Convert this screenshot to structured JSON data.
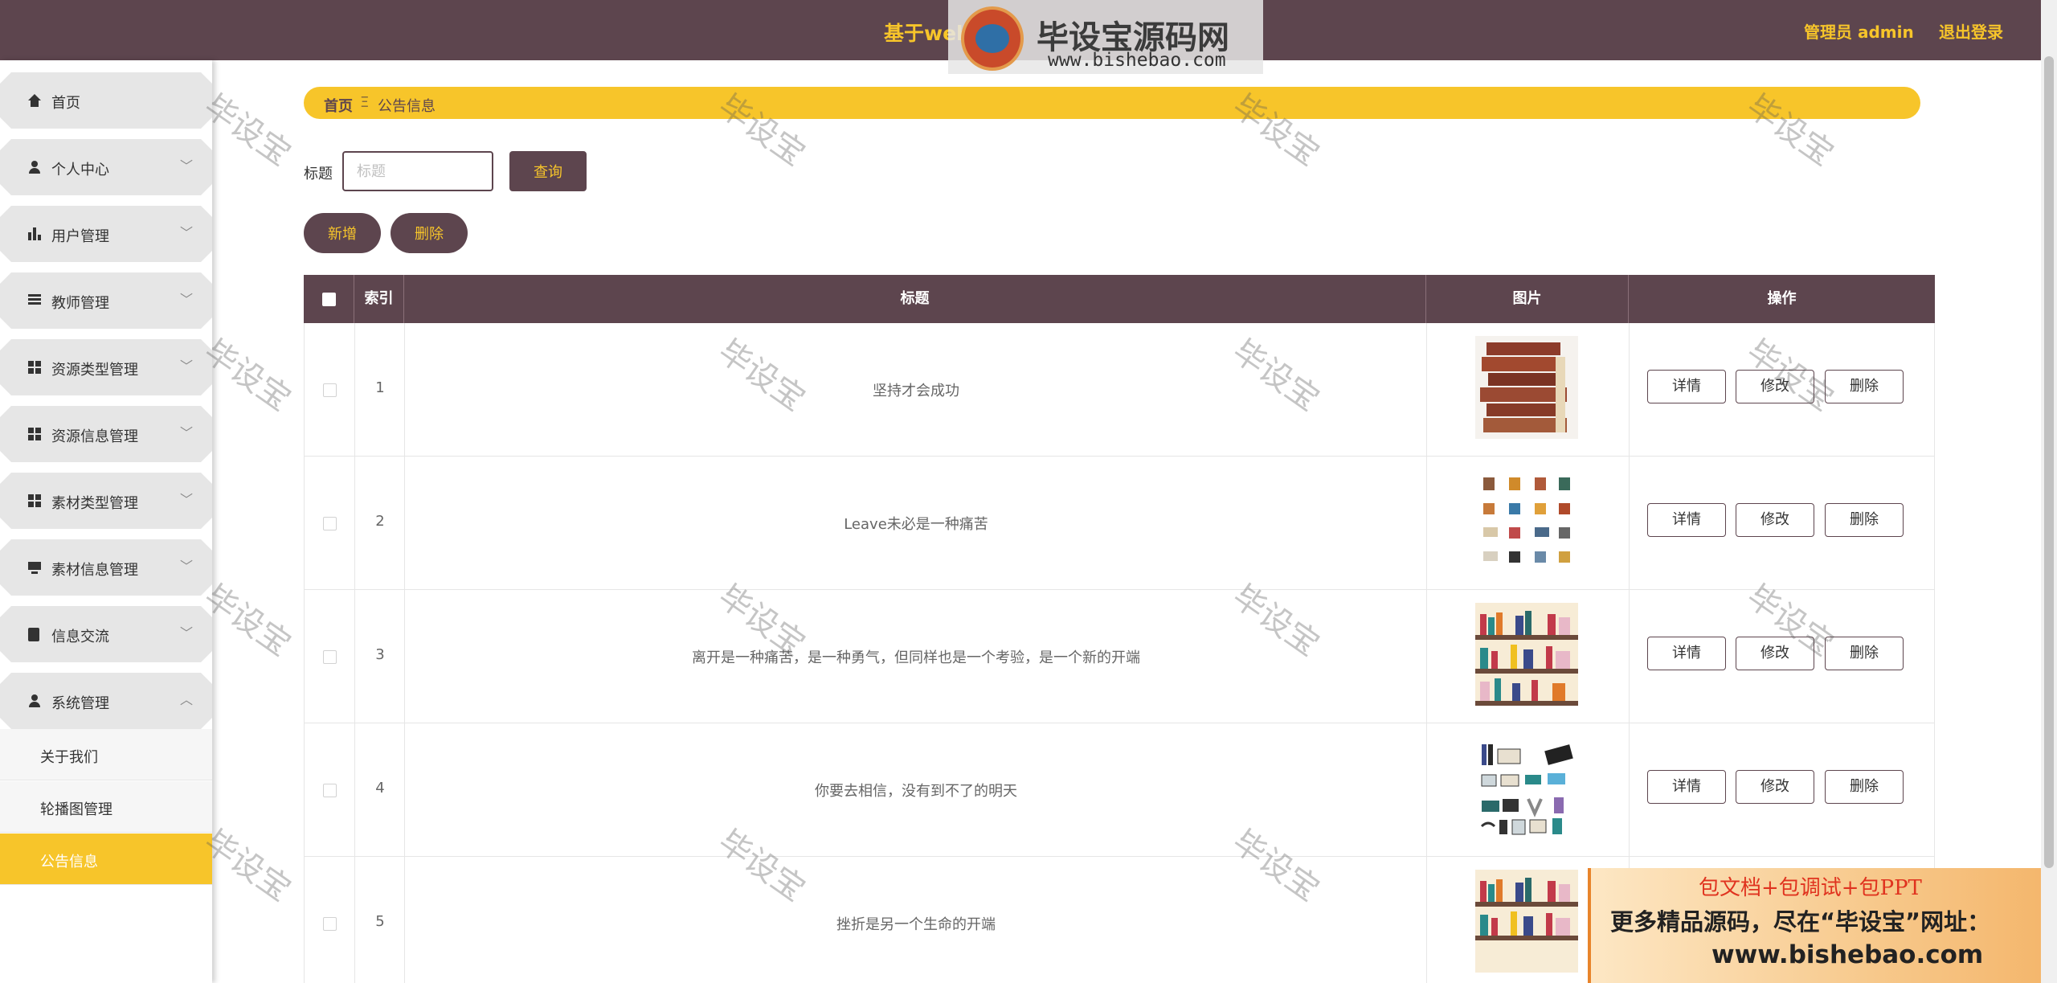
{
  "header": {
    "title": "基于web的",
    "admin_label": "管理员 admin",
    "logout_label": "退出登录"
  },
  "logo": {
    "name": "毕设宝源码网",
    "url": "www.bishebao.com"
  },
  "sidebar": {
    "items": [
      {
        "label": "首页",
        "icon": "home-icon",
        "expanded": false
      },
      {
        "label": "个人中心",
        "icon": "user-icon",
        "expanded": false
      },
      {
        "label": "用户管理",
        "icon": "bar-chart-icon",
        "expanded": false
      },
      {
        "label": "教师管理",
        "icon": "list-icon",
        "expanded": false
      },
      {
        "label": "资源类型管理",
        "icon": "grid-icon",
        "expanded": false
      },
      {
        "label": "资源信息管理",
        "icon": "grid-icon",
        "expanded": false
      },
      {
        "label": "素材类型管理",
        "icon": "grid-icon",
        "expanded": false
      },
      {
        "label": "素材信息管理",
        "icon": "monitor-icon",
        "expanded": false
      },
      {
        "label": "信息交流",
        "icon": "clipboard-icon",
        "expanded": false
      },
      {
        "label": "系统管理",
        "icon": "user-icon",
        "expanded": true
      }
    ],
    "sub_items": [
      {
        "label": "关于我们",
        "active": false
      },
      {
        "label": "轮播图管理",
        "active": false
      },
      {
        "label": "公告信息",
        "active": true
      }
    ]
  },
  "breadcrumb": {
    "home": "首页",
    "separator": "Ξ",
    "current": "公告信息"
  },
  "search": {
    "label": "标题",
    "placeholder": "标题",
    "value": "",
    "query_label": "查询"
  },
  "actions": {
    "add_label": "新增",
    "delete_label": "删除"
  },
  "table": {
    "columns": [
      "索引",
      "标题",
      "图片",
      "操作"
    ],
    "rows": [
      {
        "index": "1",
        "title": "坚持才会成功",
        "image": "stacked-books"
      },
      {
        "index": "2",
        "title": "Leave未必是一种痛苦",
        "image": "library-icons-grid"
      },
      {
        "index": "3",
        "title": "离开是一种痛苦，是一种勇气，但同样也是一个考验，是一个新的开端",
        "image": "bookshelf"
      },
      {
        "index": "4",
        "title": "你要去相信，没有到不了的明天",
        "image": "book-icons-grid"
      },
      {
        "index": "5",
        "title": "挫折是另一个生命的开端",
        "image": "bookshelf"
      }
    ],
    "row_actions": {
      "detail": "详情",
      "edit": "修改",
      "delete": "删除"
    }
  },
  "watermark": "毕设宝",
  "ad": {
    "line1": "包文档+包调试+包PPT",
    "line2": "更多精品源码，尽在“毕设宝”网址：",
    "line3": "www.bishebao.com"
  },
  "colors": {
    "primary": "#5d454e",
    "accent": "#f7c52a"
  }
}
